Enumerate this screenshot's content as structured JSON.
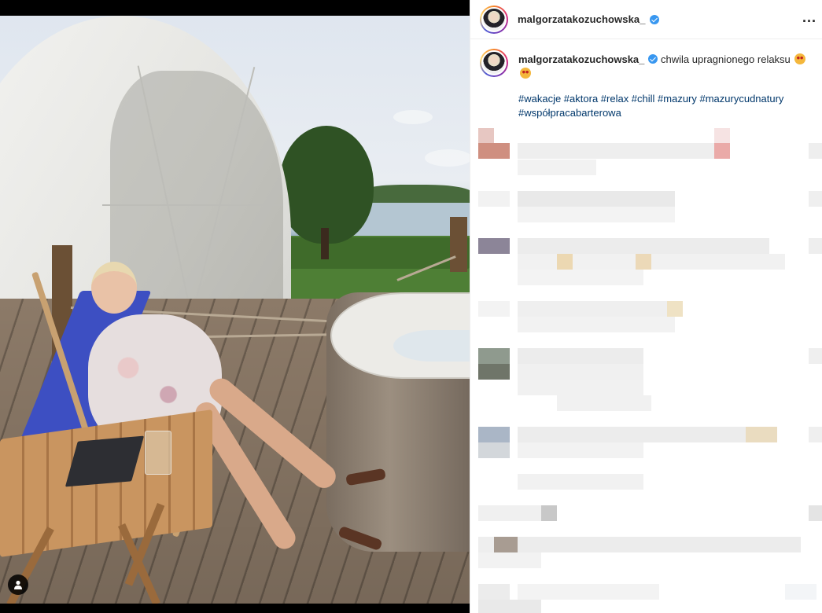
{
  "post": {
    "username": "malgorzatakozuchowska_",
    "more_label": "...",
    "caption_text": "chwila upragnionego relaksu",
    "hashtags_line1": "#wakacje #aktora #relax #chill #mazury #mazurycudnatury",
    "hashtags_line2": "#współpracabarterowa",
    "emoji_icon": "heart-eyes-emoji",
    "verified_icon": "verified-badge-icon"
  },
  "colors": {
    "verified": "#3897f0",
    "link": "#00376b",
    "username": "#262626"
  }
}
